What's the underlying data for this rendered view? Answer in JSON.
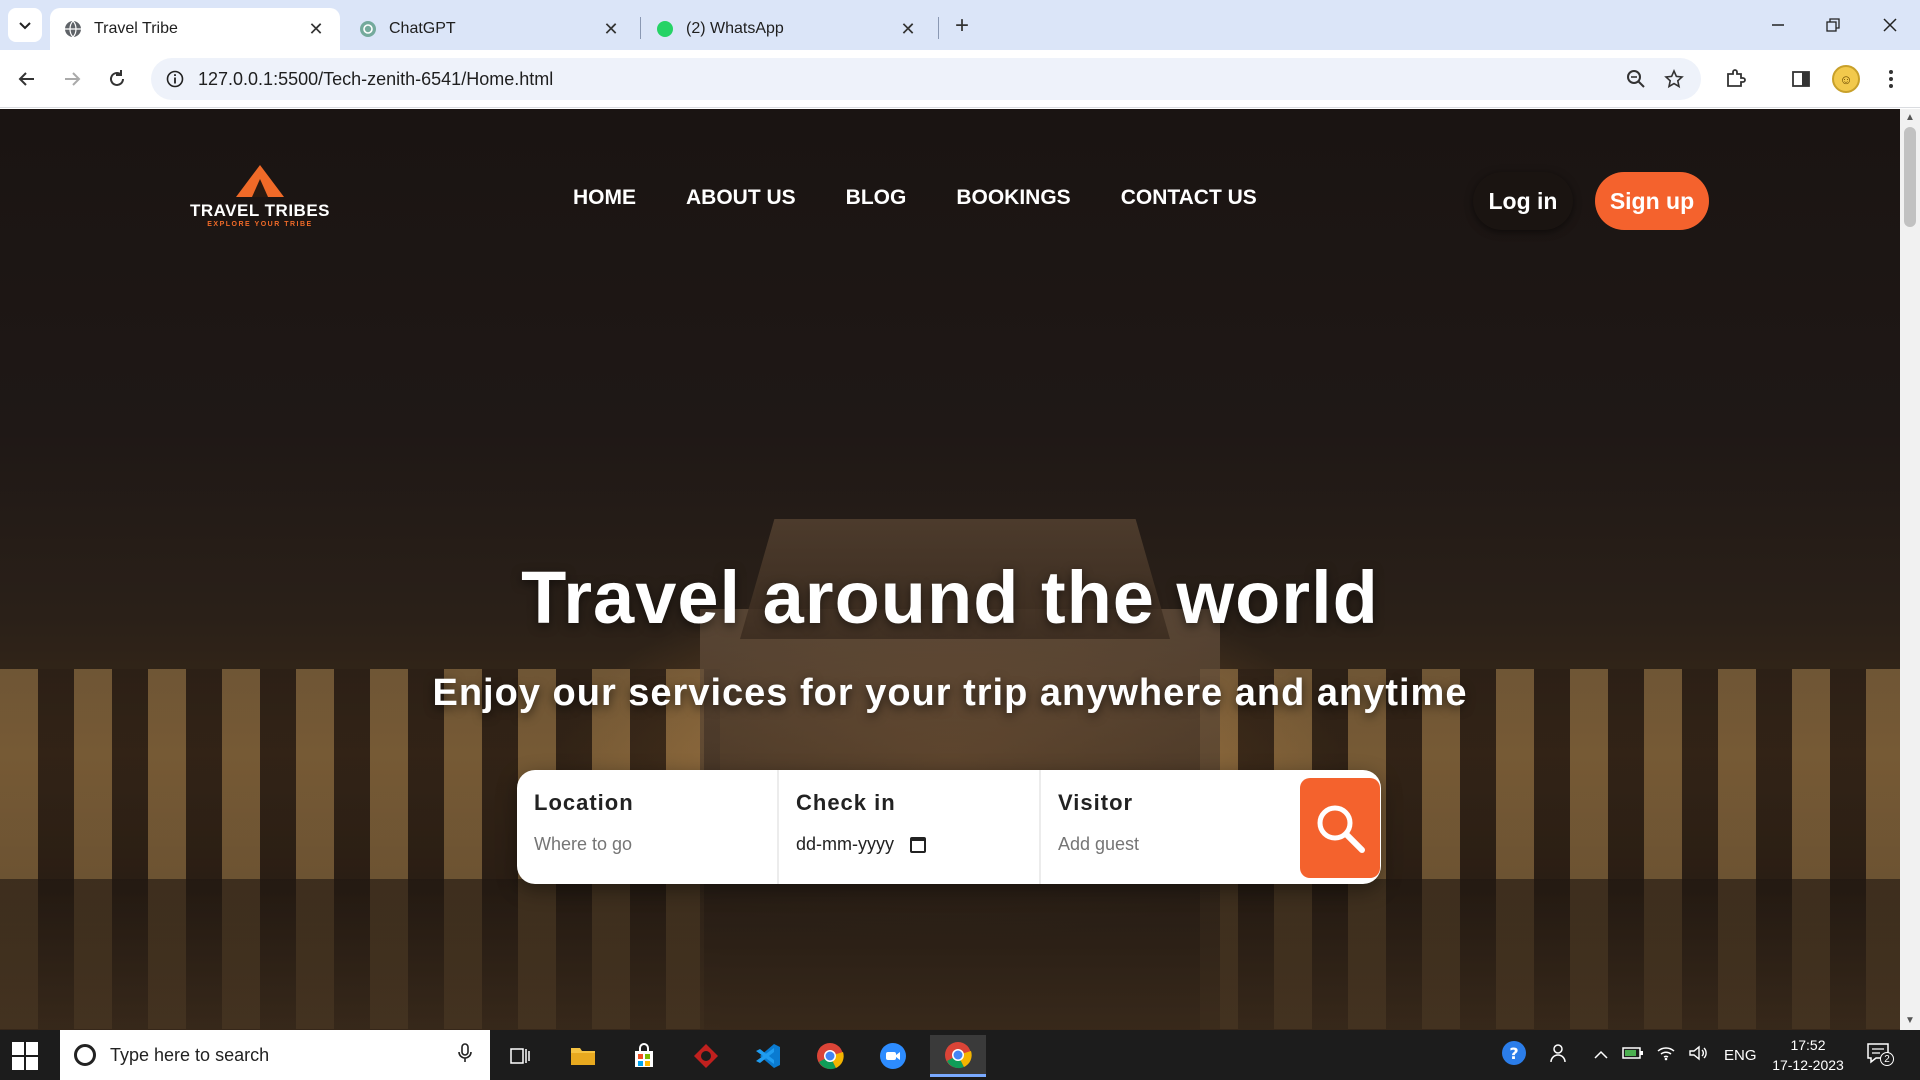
{
  "browser": {
    "tabs": [
      {
        "title": "Travel Tribe",
        "active": true
      },
      {
        "title": "ChatGPT",
        "active": false
      },
      {
        "title": "(2) WhatsApp",
        "active": false,
        "badge": "2"
      }
    ],
    "url": "127.0.0.1:5500/Tech-zenith-6541/Home.html"
  },
  "site": {
    "logo": {
      "title": "TRAVEL TRIBES",
      "tagline": "EXPLORE YOUR TRIBE"
    },
    "nav": [
      "HOME",
      "ABOUT US",
      "BLOG",
      "BOOKINGS",
      "CONTACT US"
    ],
    "login_label": "Log in",
    "signup_label": "Sign up",
    "hero": {
      "title": "Travel around the world",
      "subtitle": "Enjoy our services for your trip anywhere and anytime"
    },
    "search": {
      "location": {
        "label": "Location",
        "placeholder": "Where to go"
      },
      "checkin": {
        "label": "Check in",
        "value": "dd-mm-yyyy"
      },
      "visitor": {
        "label": "Visitor",
        "placeholder": "Add guest"
      }
    }
  },
  "taskbar": {
    "search_placeholder": "Type here to search",
    "language": "ENG",
    "time": "17:52",
    "date": "17-12-2023",
    "notification_count": "2"
  },
  "colors": {
    "accent": "#f4622d",
    "tab_strip": "#dbe5f8"
  }
}
